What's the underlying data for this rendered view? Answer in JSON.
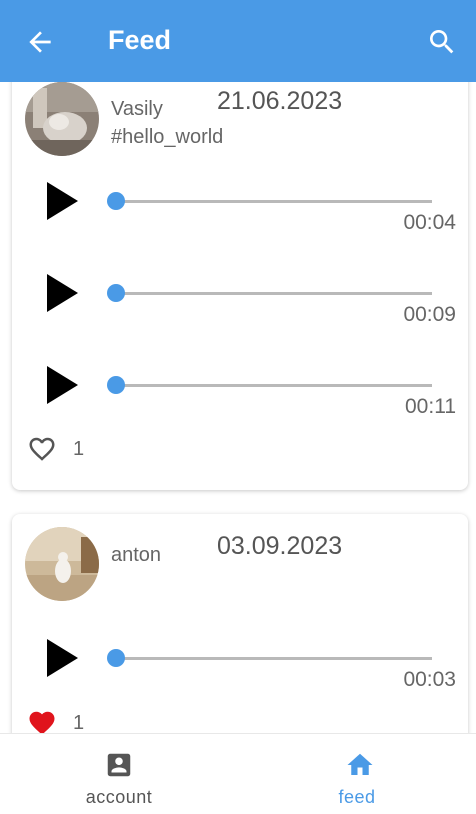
{
  "appbar": {
    "title": "Feed",
    "back_icon": "arrow-left-icon",
    "search_icon": "search-icon",
    "color": "#4a9ae6"
  },
  "posts": [
    {
      "user": "Vasily",
      "tag": "#hello_world",
      "date": "21.06.2023",
      "tracks": [
        {
          "time": "00:04",
          "progress": 0
        },
        {
          "time": "00:09",
          "progress": 0
        },
        {
          "time": "00:11",
          "progress": 0
        }
      ],
      "likes": "1",
      "liked": false
    },
    {
      "user": "anton",
      "tag": "",
      "date": "03.09.2023",
      "tracks": [
        {
          "time": "00:03",
          "progress": 0
        }
      ],
      "likes": "1",
      "liked": true
    }
  ],
  "bottomnav": {
    "items": [
      {
        "label": "account",
        "icon": "account-box-icon",
        "active": false
      },
      {
        "label": "feed",
        "icon": "home-icon",
        "active": true
      }
    ],
    "active_color": "#4a9ae6",
    "inactive_color": "#555555"
  }
}
